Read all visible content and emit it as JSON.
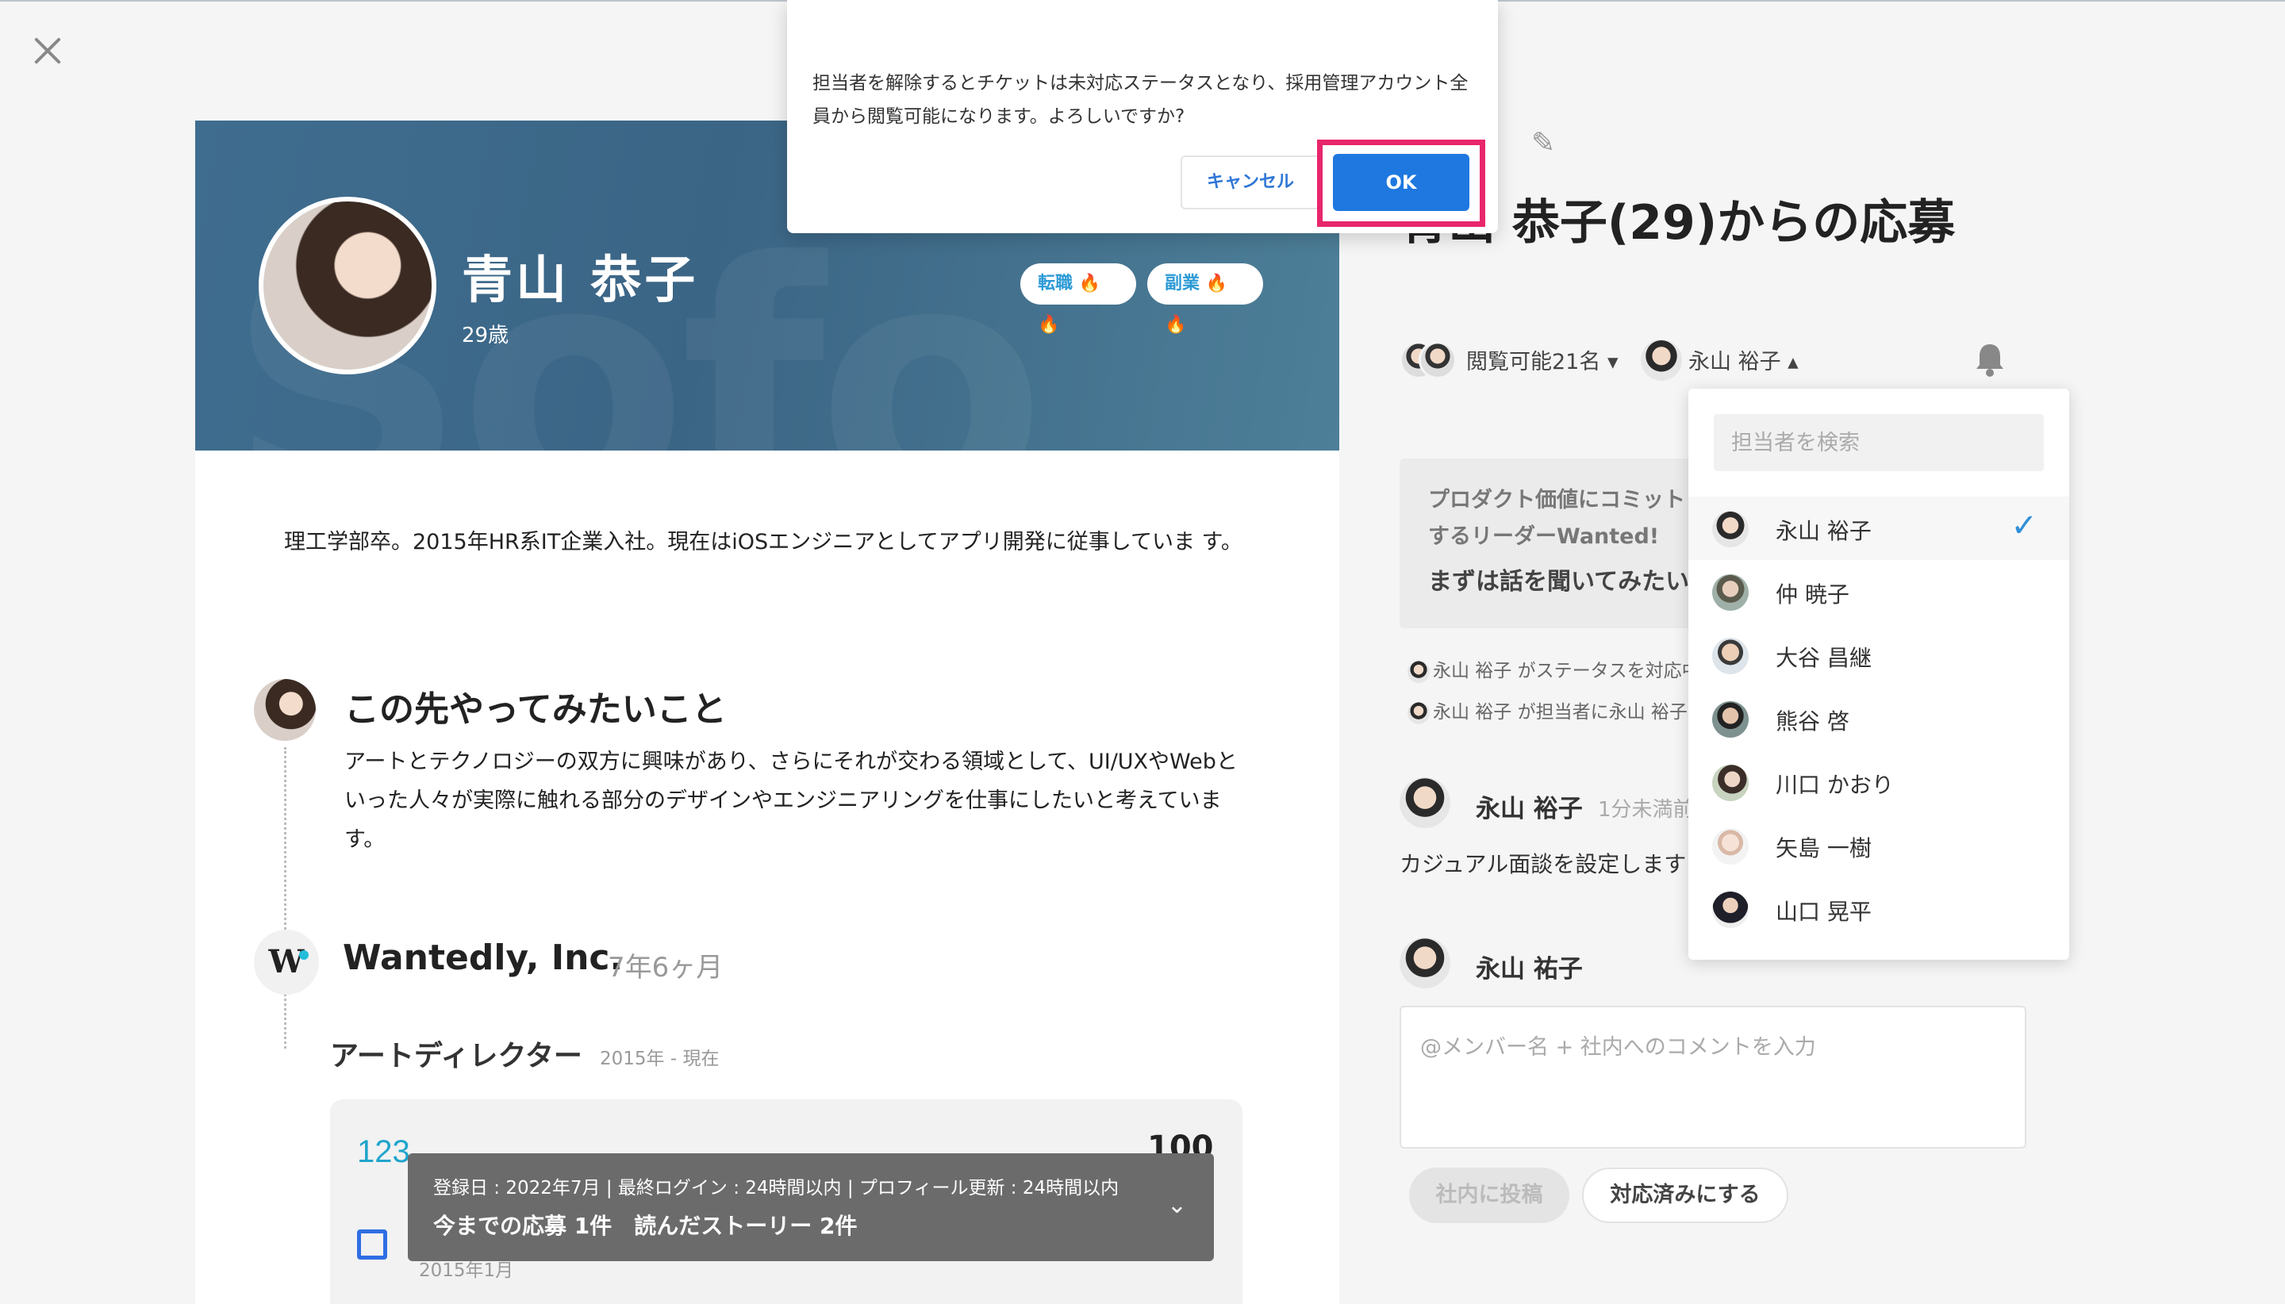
{
  "profile": {
    "name": "青山 恭子",
    "age": "29歳",
    "badges": [
      "転職 🔥🔥",
      "副業 🔥🔥"
    ],
    "intro": "理工学部卒。2015年HR系IT企業入社。現在はiOSエンジニアとしてアプリ開発に従事していま す。",
    "section_title": "この先やってみたいこと",
    "section_body": "アートとテクノロジーの双方に興味があり、さらにそれが交わる領域として、UI/UXやWebといった人々が実際に触れる部分のデザインやエンジニアリングを仕事にしたいと考えています。",
    "company_name": "Wantedly, Inc.",
    "company_duration": "7年6ヶ月",
    "job_title": "アートディレクター",
    "job_period": "2015年 - 現在",
    "work_number": "123",
    "work_value": "100",
    "work_date": "2015年1月"
  },
  "statbar": {
    "line1": "登録日 : 2022年7月 | 最終ログイン : 24時間以内 | プロフィール更新 : 24時間以内",
    "line2": "今までの応募 1件　読んだストーリー 2件"
  },
  "ticket": {
    "title": "青山 恭子(29)からの応募",
    "viewers_label": "閲覧可能21名 ▾",
    "assignee_label": "永山 裕子 ▴",
    "message_line1": "プロダクト価値にコミットするリーダーWanted!",
    "message_line2": "まずは話を聞いてみたい",
    "log1": "永山 裕子 がステータスを対応中に変更",
    "log2": "永山 裕子 が担当者に永山 裕子を設定",
    "comment_author": "永山 裕子",
    "comment_time": "1分未満前",
    "comment_text": "カジュアル面談を設定します",
    "composer_author": "永山 祐子",
    "composer_placeholder": "@メンバー名 + 社内へのコメントを入力",
    "post_button": "社内に投稿",
    "done_button": "対応済みにする"
  },
  "dropdown": {
    "search_placeholder": "担当者を検索",
    "members": [
      {
        "name": "永山 裕子",
        "selected": true
      },
      {
        "name": "仲 暁子",
        "selected": false
      },
      {
        "name": "大谷 昌継",
        "selected": false
      },
      {
        "name": "熊谷 啓",
        "selected": false
      },
      {
        "name": "川口 かおり",
        "selected": false
      },
      {
        "name": "矢島 一樹",
        "selected": false
      },
      {
        "name": "山口 晃平",
        "selected": false
      }
    ],
    "check_icon": "✓"
  },
  "dialog": {
    "message": "担当者を解除するとチケットは未対応ステータスとなり、採用管理アカウント全員から閲覧可能になります。よろしいですか?",
    "cancel_label": "キャンセル",
    "ok_label": "OK"
  },
  "colors": {
    "hero_bg": "#3f6d8f",
    "accent_blue": "#1e78e0",
    "highlight": "#e8266b",
    "check": "#2f8fd8"
  },
  "icons": {
    "close": "close-icon",
    "edit": "edit-pencil-icon",
    "bell": "bell-icon",
    "chevron": "chevron-down-icon"
  }
}
